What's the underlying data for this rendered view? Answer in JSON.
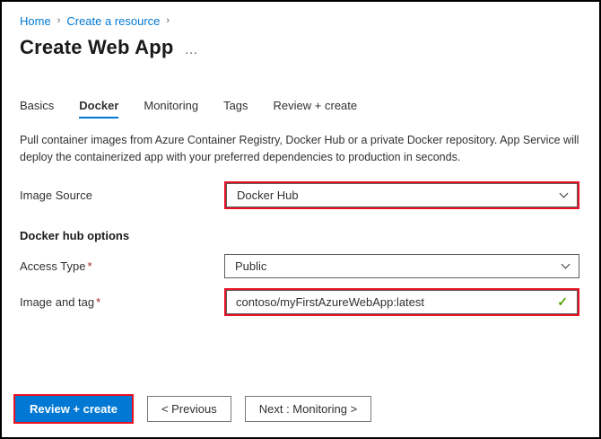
{
  "breadcrumb": {
    "items": [
      {
        "label": "Home"
      },
      {
        "label": "Create a resource"
      }
    ],
    "separator": "›"
  },
  "page": {
    "title": "Create Web App",
    "more": "…"
  },
  "tabs": [
    {
      "label": "Basics"
    },
    {
      "label": "Docker"
    },
    {
      "label": "Monitoring"
    },
    {
      "label": "Tags"
    },
    {
      "label": "Review + create"
    }
  ],
  "description": "Pull container images from Azure Container Registry, Docker Hub or a private Docker repository. App Service will deploy the containerized app with your preferred dependencies to production in seconds.",
  "form": {
    "image_source": {
      "label": "Image Source",
      "value": "Docker Hub"
    },
    "section_heading": "Docker hub options",
    "access_type": {
      "label": "Access Type",
      "required": "*",
      "value": "Public"
    },
    "image_and_tag": {
      "label": "Image and tag",
      "required": "*",
      "value": "contoso/myFirstAzureWebApp:latest",
      "valid_icon": "✓"
    }
  },
  "footer": {
    "review_create_label": "Review + create",
    "previous_label": "< Previous",
    "next_label": "Next : Monitoring >"
  },
  "colors": {
    "accent": "#0078d4",
    "highlight_red": "#e81123",
    "success_green": "#57a300",
    "required_red": "#a4262c"
  }
}
